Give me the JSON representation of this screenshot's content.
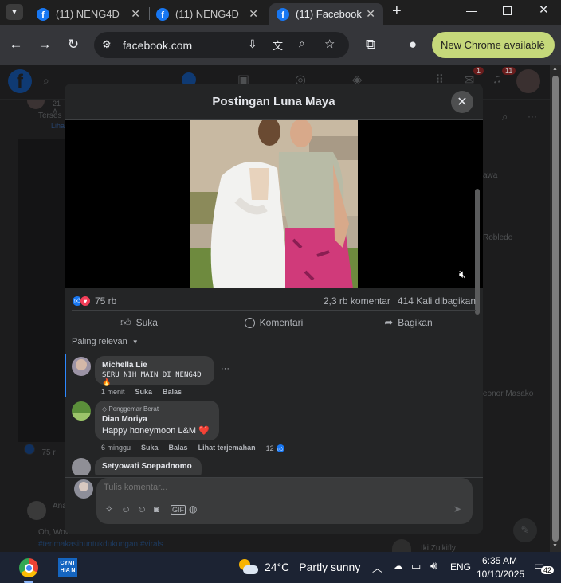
{
  "tabs": [
    {
      "title": "(11) NENG4D",
      "fav": "f"
    },
    {
      "title": "(11) NENG4D",
      "fav": "f"
    },
    {
      "title": "(11) Facebook",
      "fav": "f"
    }
  ],
  "toolbar": {
    "url": "facebook.com",
    "update_label": "New Chrome available"
  },
  "fb_bg": {
    "notif_count_1": "1",
    "notif_count_2": "11",
    "sidebar_names": [
      "awa",
      "Robledo",
      "eonor Masako",
      "Iki Zulkifly"
    ],
    "feed_snippets": [
      "21 A",
      "Terses",
      "Lihat",
      "75 r",
      "Ana",
      "Oh, Wow",
      "#terimakasihuntukdukungan #virals"
    ]
  },
  "modal": {
    "title": "Postingan Luna Maya",
    "reactions_count": "75 rb",
    "comments_count": "2,3 rb komentar",
    "shares_count": "414 Kali dibagikan",
    "actions": {
      "like": "Suka",
      "comment": "Komentari",
      "share": "Bagikan"
    },
    "sort_label": "Paling relevan",
    "comments": [
      {
        "name": "Michella Lie",
        "text": "SERU NIH MAIN DI NENG4D🔥",
        "time": "1 menit",
        "like": "Suka",
        "reply": "Balas",
        "more": "···"
      },
      {
        "badge": "Penggemar Berat",
        "name": "Dian Moriya",
        "text": "Happy honeymoon L&M ❤️",
        "time": "6 minggu",
        "like": "Suka",
        "reply": "Balas",
        "translate": "Lihat terjemahan",
        "likes": "12"
      },
      {
        "name": "Setyowati Soepadnomo"
      }
    ],
    "composer_placeholder": "Tulis komentar..."
  },
  "taskbar": {
    "temperature": "24°C",
    "weather": "Partly sunny",
    "lang": "ENG",
    "time": "6:35 AM",
    "date": "10/10/2025",
    "notif": "42",
    "app_label": "CYNT HIA N"
  },
  "colors": {
    "fb_blue": "#1877f2",
    "modal_bg": "#242526",
    "bubble": "#3a3b3c",
    "taskbar": "#1c2333"
  }
}
